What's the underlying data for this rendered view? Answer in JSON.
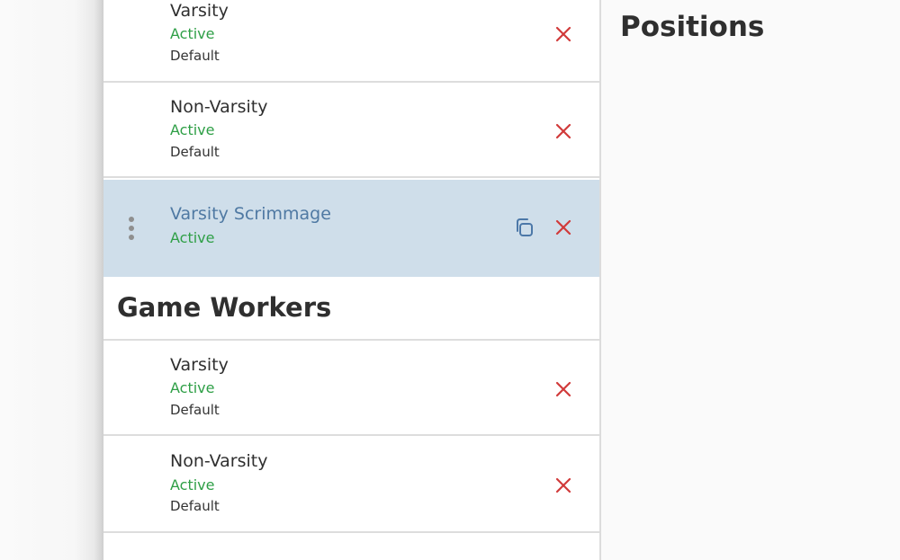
{
  "sections": {
    "top_rows": [
      {
        "title": "Varsity",
        "status": "Active",
        "meta": "Default"
      },
      {
        "title": "Non-Varsity",
        "status": "Active",
        "meta": "Default"
      },
      {
        "title": "Varsity Scrimmage",
        "status": "Active",
        "selected": true
      }
    ],
    "game_workers": {
      "title": "Game Workers",
      "rows": [
        {
          "title": "Varsity",
          "status": "Active",
          "meta": "Default"
        },
        {
          "title": "Non-Varsity",
          "status": "Active",
          "meta": "Default"
        }
      ]
    }
  },
  "right_panel": {
    "title": "Positions"
  },
  "icons": {
    "delete": "x-icon",
    "copy": "copy-icon",
    "drag": "drag-handle-icon"
  },
  "colors": {
    "active_status": "#2e9f46",
    "delete_icon": "#d13a3a",
    "selected_row": "#cfdeea",
    "selected_title": "#4f79a3",
    "copy_icon": "#4c78a8"
  }
}
